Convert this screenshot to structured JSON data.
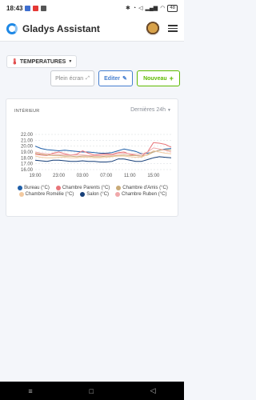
{
  "status_bar": {
    "time": "18:43",
    "battery": "48"
  },
  "header": {
    "app_title": "Gladys Assistant"
  },
  "dashboard": {
    "selector_label": "TEMPERATURES"
  },
  "actions": {
    "fullscreen_label": "Plein écran",
    "edit_label": "Editer",
    "new_label": "Nouveau"
  },
  "card": {
    "title": "INTÉRIEUR",
    "period": "Dernières 24h"
  },
  "chart_data": {
    "type": "line",
    "title": "INTÉRIEUR",
    "ylim": [
      16,
      22
    ],
    "y_ticks": [
      "22.00",
      "21.00",
      "20.00",
      "19.00",
      "18.00",
      "17.00",
      "16.00"
    ],
    "x_ticks": [
      "19:00",
      "23:00",
      "03:00",
      "07:00",
      "11:00",
      "15:00"
    ],
    "grid": true,
    "legend_position": "bottom",
    "x": [
      "19:00",
      "20:00",
      "21:00",
      "22:00",
      "23:00",
      "00:00",
      "01:00",
      "02:00",
      "03:00",
      "04:00",
      "05:00",
      "06:00",
      "07:00",
      "08:00",
      "09:00",
      "10:00",
      "11:00",
      "12:00",
      "13:00",
      "14:00",
      "15:00",
      "16:00",
      "17:00",
      "18:00"
    ],
    "series": [
      {
        "name": "Bureau (°C)",
        "color": "#1f5fa8",
        "values": [
          20.0,
          19.6,
          19.4,
          19.3,
          19.2,
          19.3,
          19.2,
          19.1,
          19.0,
          19.0,
          18.9,
          18.8,
          18.8,
          18.9,
          19.2,
          19.5,
          19.3,
          19.1,
          18.7,
          18.8,
          19.0,
          19.3,
          19.5,
          19.6
        ]
      },
      {
        "name": "Chambre Parents (°C)",
        "color": "#e8757a",
        "values": [
          18.6,
          18.5,
          18.4,
          18.8,
          19.0,
          18.7,
          18.5,
          18.6,
          19.2,
          18.8,
          18.5,
          18.6,
          18.7,
          18.6,
          18.9,
          19.0,
          18.6,
          18.4,
          18.3,
          19.0,
          20.6,
          20.5,
          20.3,
          19.8
        ]
      },
      {
        "name": "Chambre d'Amis (°C)",
        "color": "#c9aa78",
        "values": [
          18.8,
          18.6,
          18.5,
          18.4,
          18.4,
          18.3,
          18.3,
          18.2,
          18.3,
          18.3,
          18.2,
          18.2,
          18.3,
          18.3,
          18.4,
          18.5,
          18.4,
          18.4,
          18.3,
          18.5,
          19.0,
          19.3,
          19.4,
          19.3
        ]
      },
      {
        "name": "Chambre Romélie (°C)",
        "color": "#f2c9a0",
        "values": [
          18.3,
          18.1,
          18.0,
          18.0,
          18.1,
          18.1,
          18.0,
          18.0,
          18.1,
          18.1,
          18.0,
          18.0,
          18.1,
          18.2,
          18.3,
          18.3,
          18.2,
          18.1,
          18.1,
          18.6,
          19.2,
          19.0,
          18.8,
          18.7
        ]
      },
      {
        "name": "Salon (°C)",
        "color": "#163e78",
        "values": [
          17.6,
          17.5,
          17.4,
          17.6,
          17.6,
          17.5,
          17.4,
          17.4,
          17.5,
          17.4,
          17.4,
          17.3,
          17.3,
          17.4,
          17.8,
          17.8,
          17.6,
          17.4,
          17.4,
          17.7,
          18.0,
          18.2,
          18.1,
          18.0
        ]
      },
      {
        "name": "Chambre Ruben (°C)",
        "color": "#f0a8aa",
        "values": [
          19.0,
          18.8,
          18.7,
          18.6,
          18.6,
          18.5,
          18.5,
          18.5,
          18.5,
          18.4,
          18.4,
          18.4,
          18.5,
          18.5,
          18.7,
          18.8,
          18.7,
          18.6,
          18.6,
          19.0,
          19.7,
          19.5,
          19.3,
          19.0
        ]
      }
    ]
  }
}
